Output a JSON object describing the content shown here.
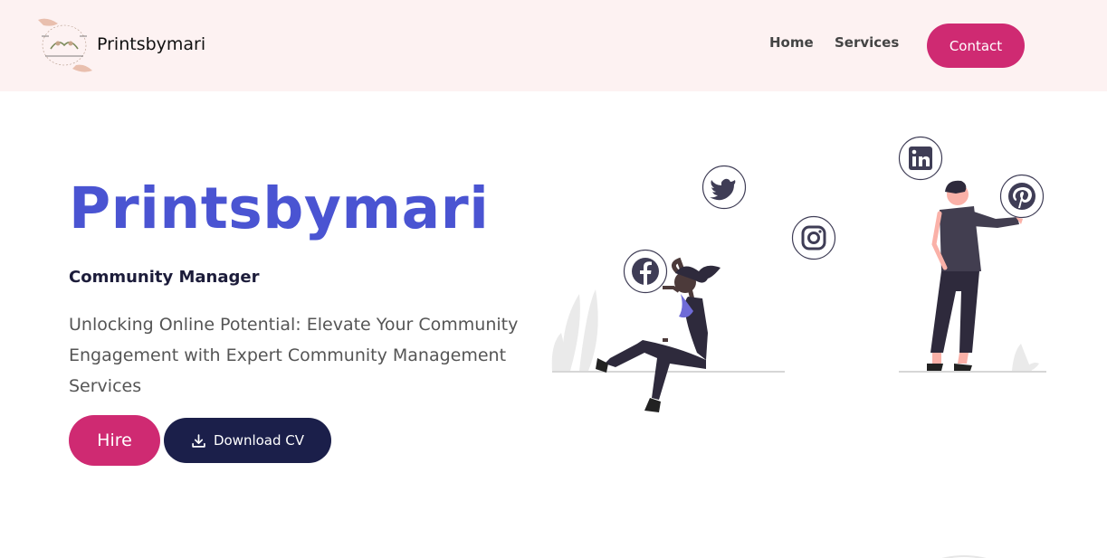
{
  "navbar": {
    "brand_name": "Printsbymari",
    "links": [
      {
        "label": "Home"
      },
      {
        "label": "Services"
      }
    ],
    "contact_label": "Contact"
  },
  "hero": {
    "title": "Printsbymari",
    "subtitle": "Community Manager",
    "description": "Unlocking Online Potential: Elevate Your Community Engagement with Expert Community Management Services",
    "hire_label": "Hire",
    "download_cv_label": "Download CV"
  },
  "illustration": {
    "icons": [
      "twitter-icon",
      "instagram-icon",
      "facebook-icon",
      "linkedin-icon",
      "pinterest-icon"
    ]
  },
  "colors": {
    "accent_pink": "#cf2a72",
    "title_blue": "#4a54d2",
    "navy": "#1b1f4a",
    "navbar_bg": "#fdf2f2"
  }
}
